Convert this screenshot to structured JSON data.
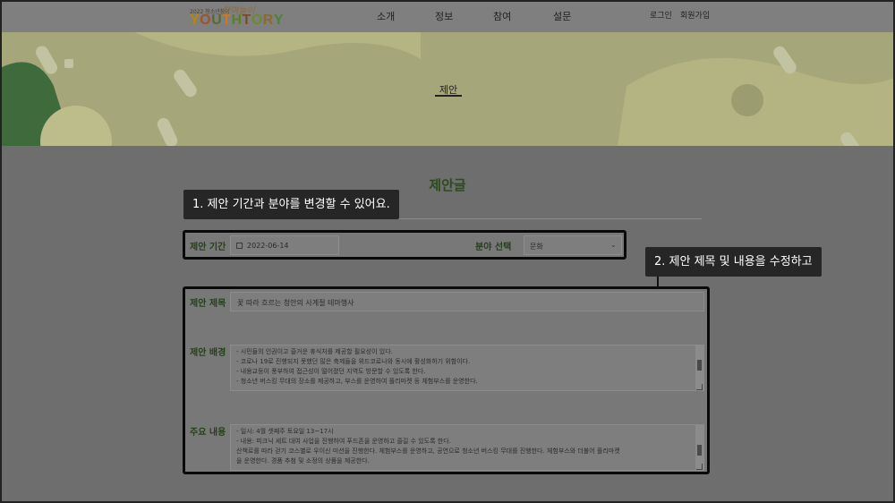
{
  "header": {
    "logo_small": "2022 청소년참여",
    "logo_script": "참여놀이",
    "logo_letters": [
      "Y",
      "O",
      "U",
      "T",
      "H",
      "T",
      "O",
      "R",
      "Y"
    ],
    "logo_colors": [
      "#b8860b",
      "#a0522d",
      "#556b2f",
      "#c77c2a",
      "#5b7f2a",
      "#7a4a2a",
      "#6a8b2a",
      "#8b6b2a",
      "#4f7f3a"
    ],
    "nav": [
      "소개",
      "정보",
      "참여",
      "설문"
    ],
    "login": "로그인",
    "signup": "회원가입"
  },
  "banner": {
    "title": "제안"
  },
  "page": {
    "title": "제안글"
  },
  "callouts": {
    "first": "1. 제안 기간과 분야를 변경할 수 있어요.",
    "second": "2. 제안 제목 및 내용을 수정하고"
  },
  "form": {
    "period_label": "제안 기간",
    "period_value": "2022-06-14",
    "category_label": "분야 선택",
    "category_value": "문화",
    "title_label": "제안 제목",
    "title_value": "꽃 따라 흐르는 청안의 사계절 테마행사",
    "background_label": "제안 배경",
    "background_lines": [
      "- 시민들의 인권이고 즐거운 휴식처를 제공할 필요성이 있다.",
      "- 코로나 19로 진행되지 못했던 많은 축제들을 위드코로나와 동시에 활성화하기 위함이다.",
      "- 내용교등이 풍부하여 접근성이 떨어졌던 지역도 방문할 수 있도록 한다.",
      "- 청소년 버스킹 무대의 장소를 제공하고, 부스를 운영하여 플리마켓 등 체험부스를 운영한다."
    ],
    "content_label": "주요 내용",
    "content_lines": [
      "- 일시: 4월 셋째주 토요일 13~17시",
      "- 내용: 피크닉 세트 대여 사업을 진행하여 푸드존을 운영하고 즐길 수 있도록 한다.",
      "산책로를 따라 걷기 코스별로 우이신 미션을 진행한다. 체험부스를 운영하고, 공연으로 청소년 버스킹 무대를 진행한다. 체험부스와 더불어 플리마켓",
      "을 운영한다. 경품 추첨 및 소정의 상품을 제공한다."
    ]
  }
}
